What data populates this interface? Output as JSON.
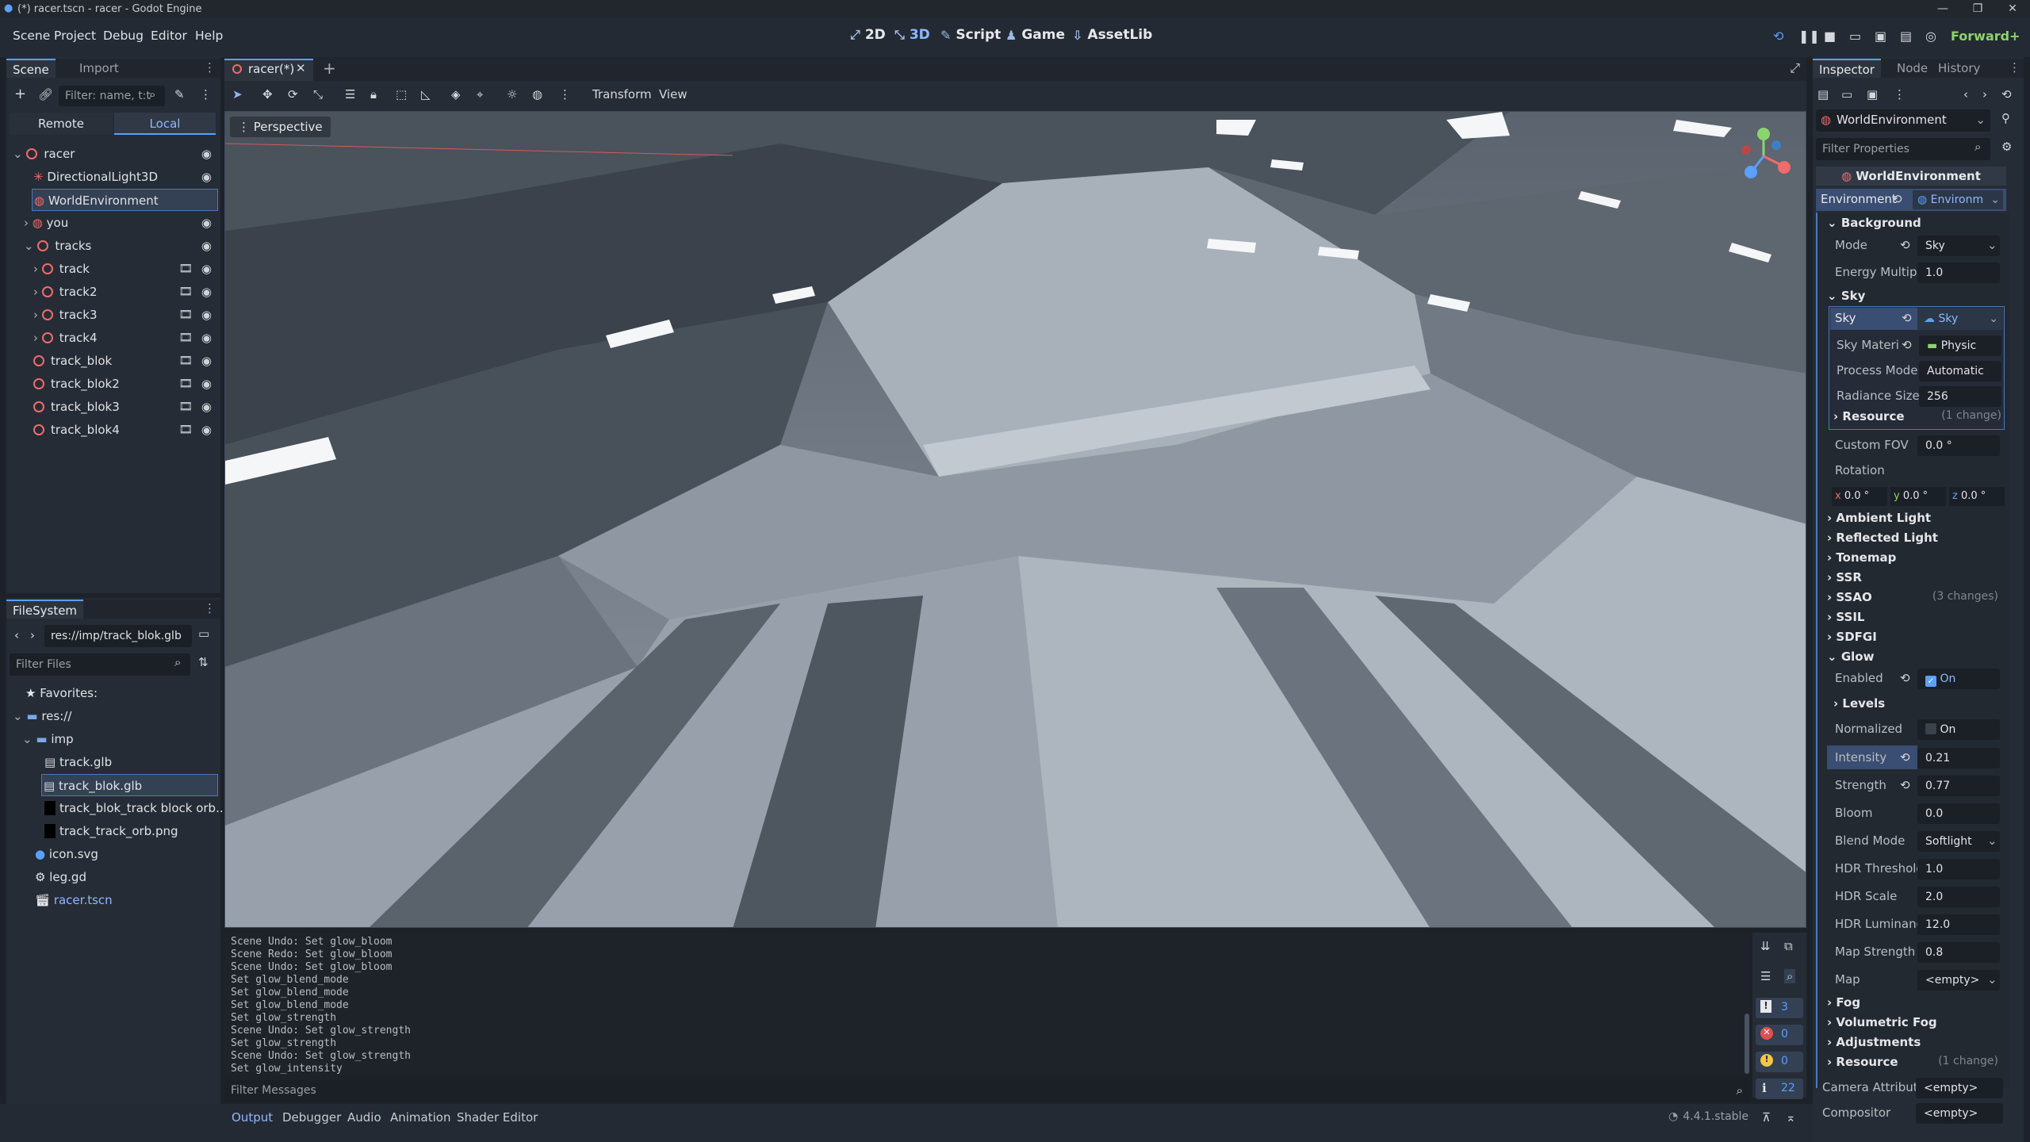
{
  "window": {
    "title": "(*) racer.tscn - racer - Godot Engine",
    "controls": [
      "—",
      "❐",
      "✕"
    ]
  },
  "menu": [
    "Scene",
    "Project",
    "Debug",
    "Editor",
    "Help"
  ],
  "workspaces": [
    {
      "label": "2D",
      "icon": "2d-icon"
    },
    {
      "label": "3D",
      "icon": "3d-icon"
    },
    {
      "label": "Script",
      "icon": "script-icon"
    },
    {
      "label": "Game",
      "icon": "game-icon"
    },
    {
      "label": "AssetLib",
      "icon": "assetlib-icon"
    }
  ],
  "renderer": "Forward+",
  "scene_dock": {
    "tabs": [
      "Scene",
      "Import"
    ],
    "filter_placeholder": "Filter: name, t:t",
    "remote": "Remote",
    "local": "Local",
    "nodes": [
      {
        "name": "racer",
        "indent": 0
      },
      {
        "name": "DirectionalLight3D",
        "indent": 1
      },
      {
        "name": "WorldEnvironment",
        "indent": 1,
        "selected": true
      },
      {
        "name": "you",
        "indent": 1
      },
      {
        "name": "tracks",
        "indent": 1
      },
      {
        "name": "track",
        "indent": 2
      },
      {
        "name": "track2",
        "indent": 2
      },
      {
        "name": "track3",
        "indent": 2
      },
      {
        "name": "track4",
        "indent": 2
      },
      {
        "name": "track_blok",
        "indent": 1
      },
      {
        "name": "track_blok2",
        "indent": 1
      },
      {
        "name": "track_blok3",
        "indent": 1
      },
      {
        "name": "track_blok4",
        "indent": 1
      }
    ]
  },
  "filesystem": {
    "tab": "FileSystem",
    "path": "res://imp/track_blok.glb",
    "filter_placeholder": "Filter Files",
    "items": [
      {
        "name": "Favorites:",
        "indent": 0
      },
      {
        "name": "res://",
        "indent": 0
      },
      {
        "name": "imp",
        "indent": 1
      },
      {
        "name": "track.glb",
        "indent": 2
      },
      {
        "name": "track_blok.glb",
        "indent": 2,
        "selected": true
      },
      {
        "name": "track_blok_track block orb...",
        "indent": 2
      },
      {
        "name": "track_track_orb.png",
        "indent": 2
      },
      {
        "name": "icon.svg",
        "indent": 1
      },
      {
        "name": "leg.gd",
        "indent": 1
      },
      {
        "name": "racer.tscn",
        "indent": 1
      }
    ]
  },
  "editor_tab": "racer(*)",
  "viewport": {
    "toolbar_transform": "Transform",
    "toolbar_view": "View",
    "perspective": "Perspective"
  },
  "console": {
    "lines": [
      "Scene Undo: Set glow_bloom",
      "Scene Redo: Set glow_bloom",
      "Scene Undo: Set glow_bloom",
      "Set glow_blend_mode",
      "Set glow_blend_mode",
      "Set glow_blend_mode",
      "Set glow_strength",
      "Scene Undo: Set glow_strength",
      "Set glow_strength",
      "Scene Undo: Set glow_strength",
      "Set glow_intensity"
    ],
    "filter_placeholder": "Filter Messages",
    "counts": {
      "messages": "3",
      "errors": "0",
      "warnings": "0",
      "info": "22"
    }
  },
  "bottom_tabs": [
    "Output",
    "Debugger",
    "Audio",
    "Animation",
    "Shader Editor"
  ],
  "version": "4.4.1.stable",
  "inspector": {
    "tabs": [
      "Inspector",
      "Node",
      "History"
    ],
    "object": "WorldEnvironment",
    "filter_placeholder": "Filter Properties",
    "header": "WorldEnvironment",
    "env_label": "Environment",
    "env_value": "Environm",
    "background_section": "Background",
    "mode_label": "Mode",
    "mode_value": "Sky",
    "energy_label": "Energy Multipli",
    "energy_value": "1.0",
    "sky_section": "Sky",
    "sky_label": "Sky",
    "sky_value": "Sky",
    "sky_material_label": "Sky Materi",
    "sky_material_value": "Physic",
    "process_mode_label": "Process Mode",
    "process_mode_value": "Automatic",
    "radiance_label": "Radiance Size",
    "radiance_value": "256",
    "resource_label": "Resource",
    "resource_changes": "(1 change)",
    "fov_label": "Custom FOV",
    "fov_value": "0.0 °",
    "rotation_label": "Rotation",
    "rotation_axes": [
      "x",
      "y",
      "z"
    ],
    "rotation_values": [
      "0.0 °",
      "0.0 °",
      "0.0 °"
    ],
    "sections": [
      "Ambient Light",
      "Reflected Light",
      "Tonemap",
      "SSR",
      "SSAO",
      "SSIL",
      "SDFGI",
      "Glow"
    ],
    "ssao_changes": "(3 changes)",
    "glow_enabled_label": "Enabled",
    "glow_enabled_value": "On",
    "levels": "Levels",
    "normalized_label": "Normalized",
    "normalized_value": "On",
    "intensity_label": "Intensity",
    "intensity_value": "0.21",
    "strength_label": "Strength",
    "strength_value": "0.77",
    "bloom_label": "Bloom",
    "bloom_value": "0.0",
    "blend_label": "Blend Mode",
    "blend_value": "Softlight",
    "hdr_threshold_label": "HDR Threshold",
    "hdr_threshold_value": "1.0",
    "hdr_scale_label": "HDR Scale",
    "hdr_scale_value": "2.0",
    "hdr_lum_label": "HDR Luminanc",
    "hdr_lum_value": "12.0",
    "map_strength_label": "Map Strength",
    "map_strength_value": "0.8",
    "map_label": "Map",
    "map_value": "<empty>",
    "after_sections": [
      "Fog",
      "Volumetric Fog",
      "Adjustments",
      "Resource"
    ],
    "resource2_changes": "(1 change)",
    "camera_attr_label": "Camera Attribut",
    "camera_attr_value": "<empty>",
    "compositor_label": "Compositor",
    "compositor_value": "<empty>"
  }
}
